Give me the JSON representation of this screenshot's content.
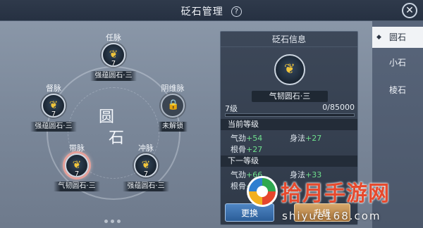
{
  "header": {
    "title": "砭石管理",
    "help_icon": "question-mark-icon",
    "help_glyph": "?",
    "close_icon": "close-icon",
    "close_glyph": "✕"
  },
  "left": {
    "center_char_1": "圆",
    "center_char_2": "石",
    "nodes": [
      {
        "meridian": "任脉",
        "level": "7",
        "stone": "强蕴圆石·三",
        "state": "equipped"
      },
      {
        "meridian": "督脉",
        "level": "7",
        "stone": "强蕴圆石·三",
        "state": "equipped"
      },
      {
        "meridian": "阴维脉",
        "level": "",
        "stone": "未解锁",
        "state": "locked",
        "icon": "lock-icon",
        "glyph": "🔒"
      },
      {
        "meridian": "带脉",
        "level": "7",
        "stone": "气韧圆石·三",
        "state": "selected"
      },
      {
        "meridian": "冲脉",
        "level": "7",
        "stone": "强蕴圆石·三",
        "state": "equipped"
      }
    ],
    "stone_icon": "gold-lotus-gem-icon",
    "stone_glyph": "❦"
  },
  "info": {
    "heading": "砭石信息",
    "name": "气韧圆石·三",
    "level_label": "7级",
    "exp_current": "0",
    "exp_max": "/85000",
    "progress": 0,
    "current": {
      "title": "当前等级",
      "stats": [
        {
          "key": "气劲",
          "val": "+54"
        },
        {
          "key": "身法",
          "val": "+27"
        },
        {
          "key": "根骨",
          "val": "+27"
        }
      ]
    },
    "next": {
      "title": "下一等级",
      "stats": [
        {
          "key": "气劲",
          "val": "+66"
        },
        {
          "key": "身法",
          "val": "+33"
        },
        {
          "key": "根骨",
          "val": "+33"
        }
      ]
    },
    "swap_label": "更换",
    "upgrade_label": "升级"
  },
  "tabs": [
    {
      "label": "圆石",
      "active": true,
      "marker": "◆"
    },
    {
      "label": "小石",
      "active": false
    },
    {
      "label": "棱石",
      "active": false
    }
  ],
  "watermark": {
    "brand": "拾月手游网",
    "url": "shiyue168.com"
  },
  "colors": {
    "stat_positive": "#6fe08d",
    "gem_gold": "#f0c53b",
    "swap_button": "#3a70b0",
    "upgrade_button": "#c08a4c"
  }
}
